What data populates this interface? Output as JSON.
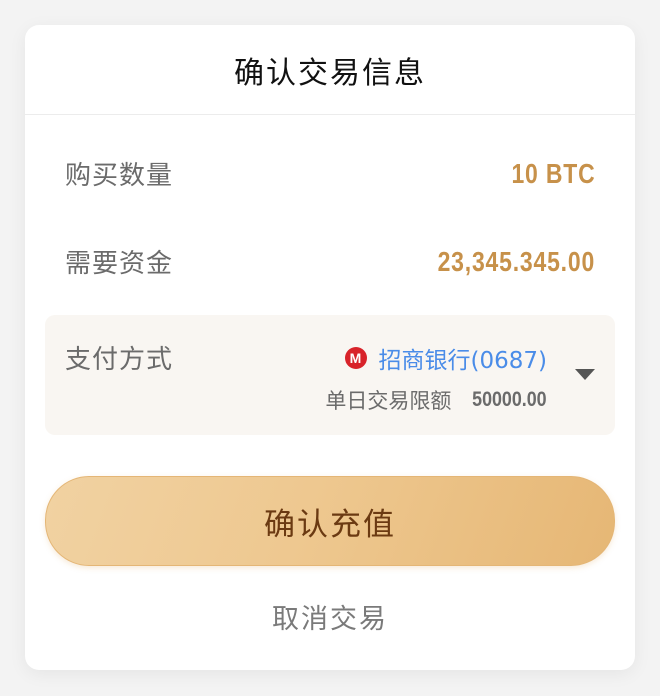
{
  "dialog": {
    "title": "确认交易信息",
    "quantity": {
      "label": "购买数量",
      "value": "10 BTC"
    },
    "funds": {
      "label": "需要资金",
      "value": "23,345.345.00"
    },
    "payment": {
      "label": "支付方式",
      "bank_name": "招商银行(0687)",
      "bank_icon": "china-merchants-bank-logo",
      "bank_logo_glyph": "M",
      "limit_label": "单日交易限额",
      "limit_value": "50000.00",
      "dropdown_icon": "caret-down-icon"
    },
    "confirm_label": "确认充值",
    "cancel_label": "取消交易"
  },
  "colors": {
    "value_accent": "#c7914a",
    "bank_link": "#4a8ce8",
    "bank_logo_red": "#d8232a",
    "button_gradient_start": "#f1d2a2",
    "button_gradient_end": "#e6b775",
    "button_text": "#6b3a12"
  }
}
